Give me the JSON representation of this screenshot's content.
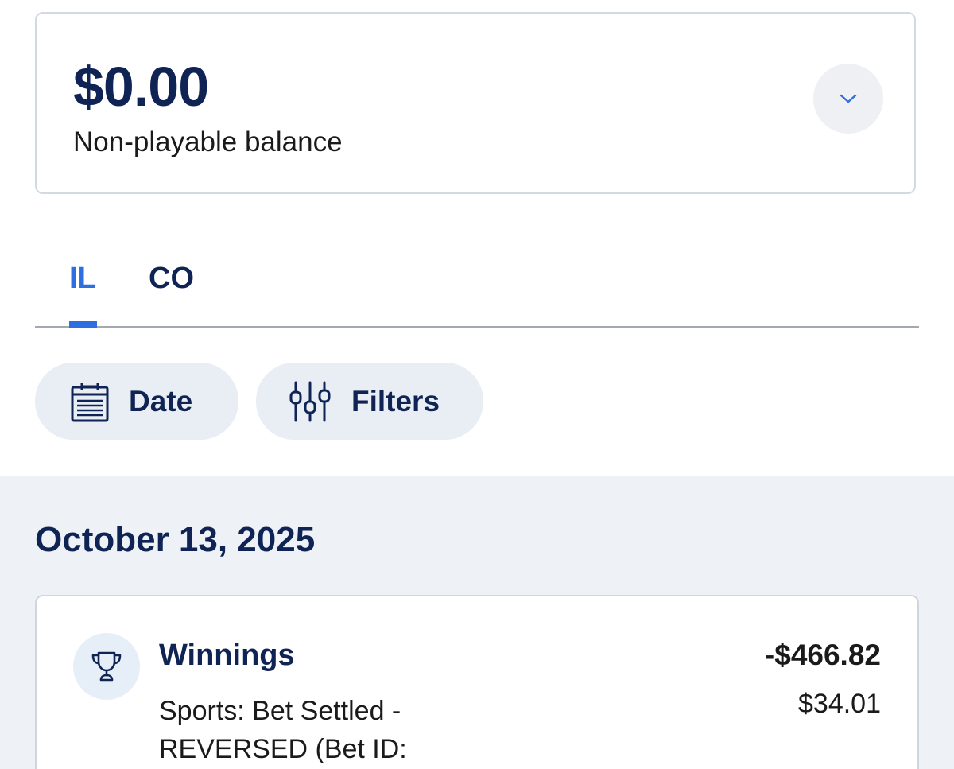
{
  "balance": {
    "amount": "$0.00",
    "label": "Non-playable balance"
  },
  "tabs": [
    {
      "label": "IL",
      "active": true
    },
    {
      "label": "CO",
      "active": false
    }
  ],
  "filters": {
    "date_label": "Date",
    "filters_label": "Filters"
  },
  "transactions": {
    "date": "October 13, 2025",
    "items": [
      {
        "icon": "trophy-icon",
        "title": "Winnings",
        "description": "Sports: Bet Settled - REVERSED (Bet ID:",
        "amount": "-$466.82",
        "balance": "$34.01"
      }
    ]
  },
  "colors": {
    "navy": "#0f2454",
    "accent": "#2f6ee0",
    "pill_bg": "#e9eef5",
    "list_bg": "#eef2f7"
  }
}
